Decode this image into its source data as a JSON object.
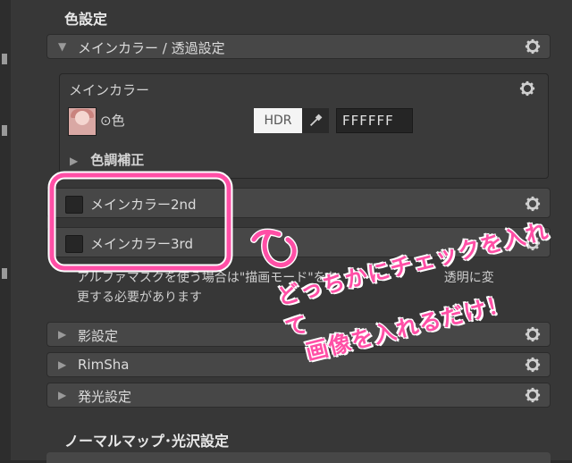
{
  "sections": {
    "color_settings": "色設定",
    "normal_map": "ノーマルマップ･光沢設定"
  },
  "folds": {
    "main_color": "メインカラー / 透過設定",
    "shadow": "影設定",
    "rim": "RimSha",
    "emission": "発光設定"
  },
  "main_color_box": {
    "title": "メインカラー",
    "color_label": "⊙色",
    "hdr": "HDR",
    "hex": "FFFFFF",
    "tone_correction": "色調補正"
  },
  "checkboxes": [
    {
      "label": "メインカラー2nd",
      "checked": false
    },
    {
      "label": "メインカラー3rd",
      "checked": false
    }
  ],
  "note": {
    "line1": "アルファマスクを使う場合は\"描画モード\"をち",
    "line1b": "透明に変",
    "line2": "更する必要があります"
  },
  "annotation": {
    "line1": "どっちかにチェックを入れて",
    "line2": "画像を入れるだけ！",
    "color": "#ff4fa6"
  },
  "icons": [
    "gear-icon",
    "eyedropper-icon",
    "triangle-right-icon",
    "triangle-down-icon"
  ]
}
